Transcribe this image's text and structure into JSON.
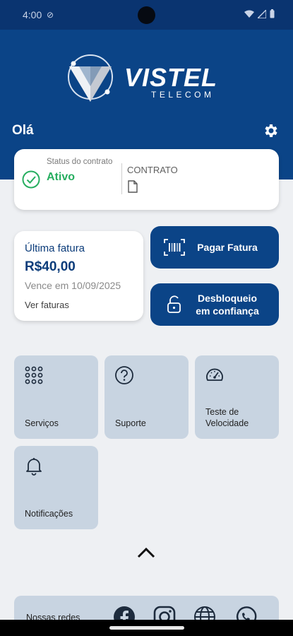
{
  "status_bar": {
    "time": "4:00"
  },
  "brand": {
    "name": "VISTEL",
    "sub": "TELECOM"
  },
  "greeting": "Olá",
  "contract": {
    "status_label": "Status do contrato",
    "status_value": "Ativo",
    "contract_label": "CONTRATO"
  },
  "invoice": {
    "title": "Última fatura",
    "amount": "R$40,00",
    "due": "Vence em 10/09/2025",
    "link": "Ver faturas"
  },
  "actions": {
    "pay": "Pagar Fatura",
    "unlock_line1": "Desbloqueio",
    "unlock_line2": "em confiança"
  },
  "tiles": {
    "services": "Serviços",
    "support": "Suporte",
    "speed_line1": "Teste de",
    "speed_line2": "Velocidade",
    "notifications": "Notificações"
  },
  "social": {
    "label": "Nossas redes"
  },
  "colors": {
    "primary": "#0b4487",
    "status_bar": "#0a3470",
    "success": "#27ae60",
    "tile": "#c8d4e1",
    "background": "#eef0f3"
  }
}
